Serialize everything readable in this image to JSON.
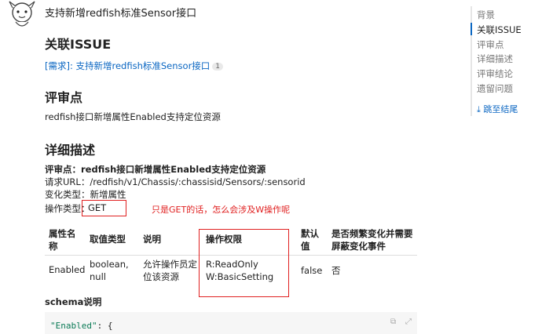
{
  "topic": {
    "title": "支持新增redfish标准Sensor接口"
  },
  "sections": {
    "issue": {
      "heading": "关联ISSUE",
      "link_text": "[需求]: 支持新增redfish标准Sensor接口",
      "link_count": "1"
    },
    "review": {
      "heading": "评审点",
      "text": "redfish接口新增属性Enabled支持定位资源"
    },
    "detail": {
      "heading": "详细描述",
      "review_label": "评审点：",
      "review_value": "redfish接口新增属性Enabled支持定位资源",
      "url_label": "请求URL：",
      "url_value": "/redfish/v1/Chassis/:chassisid/Sensors/:sensorid",
      "change_label": "变化类型：",
      "change_value": "新增属性",
      "op_label": "操作类型：",
      "op_value": "GET",
      "annotation": "只是GET的话，怎么会涉及W操作呢"
    },
    "table": {
      "headers": [
        "属性名称",
        "取值类型",
        "说明",
        "操作权限",
        "默认值",
        "是否频繁变化并需要屏蔽变化事件"
      ],
      "header_lines": {
        "h0a": "属性名",
        "h0b": "称",
        "h4a": "默认",
        "h4b": "值",
        "h5a": "是否频繁变化并需要",
        "h5b": "屏蔽变化事件"
      },
      "row": {
        "name": "Enabled",
        "type_a": "boolean,",
        "type_b": "null",
        "desc_a": "允许操作员定",
        "desc_b": "位该资源",
        "perm_a": "R:ReadOnly",
        "perm_b": "W:BasicSetting",
        "default": "false",
        "frequent": "否"
      }
    },
    "schema": {
      "heading": "schema说明",
      "code_key": "\"Enabled\"",
      "code_rest": ": {"
    }
  },
  "toc": {
    "items": [
      "背景",
      "关联ISSUE",
      "评审点",
      "详细描述",
      "评审结论",
      "遗留问题"
    ],
    "active_index": 1,
    "jump_label": "跳至结尾"
  },
  "colors": {
    "link": "#0a66c2",
    "annotation": "#e02020",
    "code_key": "#0a7a55"
  }
}
